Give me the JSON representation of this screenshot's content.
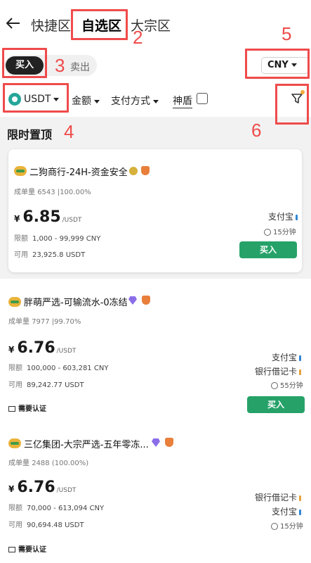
{
  "nav": {
    "tabs": [
      {
        "label": "快捷区"
      },
      {
        "label": "自选区"
      },
      {
        "label": "大宗区"
      }
    ]
  },
  "annotations": [
    "2",
    "3",
    "4",
    "5",
    "6"
  ],
  "trade_toggle": {
    "buy": "买入",
    "sell": "卖出"
  },
  "currency": {
    "value": "CNY"
  },
  "filters": {
    "coin": "USDT",
    "amount": "金额",
    "payment": "支付方式",
    "shield": "神盾"
  },
  "section_title": "限时置顶",
  "labels": {
    "completed": "成单量",
    "limit": "限额",
    "available": "可用",
    "buy": "买入",
    "verify": "需要认证"
  },
  "merchants": [
    {
      "name": "二狗商行-24H-资金安全",
      "orders": "6543 |100.00%",
      "price": "6.85",
      "unit": "/USDT",
      "limit": "1,000 - 99,999 CNY",
      "available": "23,925.8 USDT",
      "payments": [
        "支付宝"
      ],
      "time": "15分钟"
    },
    {
      "name": "胖萌严选-可输流水-0冻结",
      "orders": "7977 |99.70%",
      "price": "6.76",
      "unit": "/USDT",
      "limit": "100,000 - 603,281 CNY",
      "available": "89,242.77 USDT",
      "payments": [
        "支付宝",
        "银行借记卡"
      ],
      "time": "55分钟"
    },
    {
      "name": "三亿集团-大宗严选-五年零冻...",
      "orders": "2488 (100.00%)",
      "price": "6.76",
      "unit": "/USDT",
      "limit": "70,000 - 613,094 CNY",
      "available": "90,694.48 USDT",
      "payments": [
        "银行借记卡",
        "支付宝"
      ],
      "time": "15分钟"
    }
  ],
  "colors": {
    "annotation": "#ef4b4b",
    "buy_button": "#26a269",
    "avatar": "#e9b33a"
  }
}
